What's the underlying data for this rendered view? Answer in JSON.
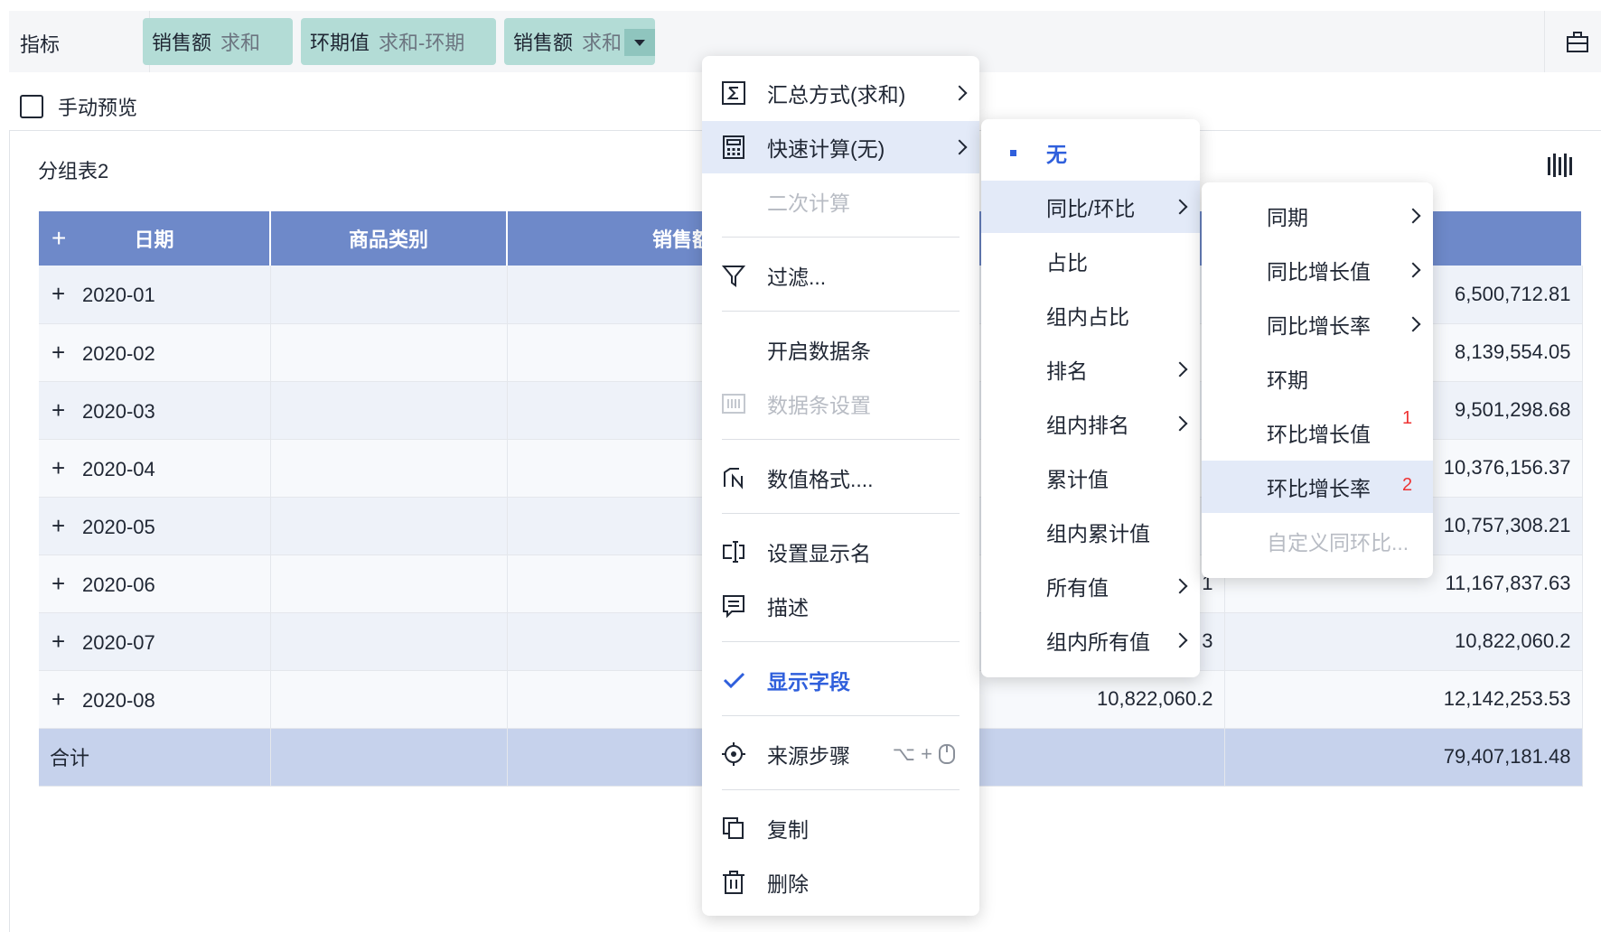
{
  "toolbar": {
    "label": "指标",
    "pills": [
      {
        "name": "销售额",
        "agg": "求和"
      },
      {
        "name": "环期值",
        "agg": "求和-环期"
      },
      {
        "name": "销售额",
        "agg": "求和"
      }
    ]
  },
  "manual_preview": "手动预览",
  "panel_title": "分组表2",
  "table": {
    "headers": [
      "+",
      "日期",
      "商品类别",
      "销售额"
    ],
    "rows": [
      {
        "date": "2020-01",
        "c3": "",
        "c4": "6,500,712.81"
      },
      {
        "date": "2020-02",
        "c3": "",
        "c4": "8,139,554.05"
      },
      {
        "date": "2020-03",
        "c3": "",
        "c4": "9,501,298.68"
      },
      {
        "date": "2020-04",
        "c3": "",
        "c4": "10,376,156.37"
      },
      {
        "date": "2020-05",
        "c3": "",
        "c4": "10,757,308.21"
      },
      {
        "date": "2020-06",
        "c3": "1",
        "c4": "11,167,837.63"
      },
      {
        "date": "2020-07",
        "c3": "3",
        "c4": "10,822,060.2"
      },
      {
        "date": "2020-08",
        "c3": "10,822,060.2",
        "c4": "12,142,253.53"
      }
    ],
    "total_label": "合计",
    "total_value": "79,407,181.48"
  },
  "menu1": {
    "items": [
      {
        "label": "汇总方式(求和)",
        "icon": "sigma-icon"
      },
      {
        "label": "快速计算(无)",
        "icon": "calculator-icon"
      },
      {
        "label": "二次计算"
      },
      {
        "label": "过滤...",
        "icon": "filter-icon"
      },
      {
        "label": "开启数据条"
      },
      {
        "label": "数据条设置",
        "icon": "databar-icon"
      },
      {
        "label": "数值格式....",
        "icon": "number-format-icon"
      },
      {
        "label": "设置显示名",
        "icon": "rename-icon"
      },
      {
        "label": "描述",
        "icon": "description-icon"
      },
      {
        "label": "显示字段",
        "icon": "check-icon"
      },
      {
        "label": "来源步骤",
        "icon": "target-icon",
        "shortcut": "⌥ +"
      },
      {
        "label": "复制",
        "icon": "copy-icon"
      },
      {
        "label": "删除",
        "icon": "trash-icon"
      }
    ]
  },
  "menu2": {
    "items": [
      "无",
      "同比/环比",
      "占比",
      "组内占比",
      "排名",
      "组内排名",
      "累计值",
      "组内累计值",
      "所有值",
      "组内所有值"
    ]
  },
  "menu3": {
    "items": [
      "同期",
      "同比增长值",
      "同比增长率",
      "环期",
      "环比增长值",
      "环比增长率",
      "自定义同环比..."
    ],
    "badges": [
      "1",
      "2"
    ]
  },
  "colors": {
    "header": "#6e89c9",
    "pill": "#b3dcd6",
    "accent": "#2f5fdc",
    "badge": "#ee3333"
  }
}
